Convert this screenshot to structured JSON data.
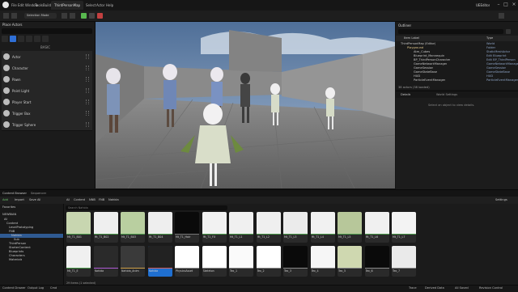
{
  "menubar": {
    "items": [
      "File",
      "Edit",
      "Window",
      "Tools",
      "Build",
      "Select",
      "Actor",
      "Help"
    ],
    "doc_tab": "ThirdPersonMap",
    "project": "UEEditor"
  },
  "toolbar": {
    "mode": "Selection Mode"
  },
  "place_actors": {
    "title": "Place Actors",
    "category": "BASIC",
    "items": [
      "Actor",
      "Character",
      "Pawn",
      "Point Light",
      "Player Start",
      "Trigger Box",
      "Trigger Sphere"
    ]
  },
  "outliner": {
    "title": "Outliner",
    "col_label": "Item Label",
    "col_type": "Type",
    "rows": [
      {
        "name": "ThirdPersonMap (Editor)",
        "type": "World"
      },
      {
        "name": "Playground",
        "type": "Folder"
      },
      {
        "name": "Atm_Cubes",
        "type": "StaticMeshActor"
      },
      {
        "name": "Blueprint_Mannequin",
        "type": "Edit Blueprint"
      },
      {
        "name": "BP_ThirdPersonCharacter",
        "type": "Edit BP_ThirdPerson"
      },
      {
        "name": "GameNetworkManager",
        "type": "GameNetworkManager"
      },
      {
        "name": "GameSession",
        "type": "GameSession"
      },
      {
        "name": "GameStateBase",
        "type": "GameStateBase"
      },
      {
        "name": "HUD",
        "type": "HUD"
      },
      {
        "name": "ParticleEventManager",
        "type": "ParticleEventManager"
      }
    ],
    "status": "38 actors (38 loaded)"
  },
  "details": {
    "tabs": [
      "Details",
      "World Settings"
    ],
    "message": "Select an object to view details."
  },
  "content_browser": {
    "tabs": [
      "Content Browser",
      "Sequencer"
    ],
    "add": "Add",
    "import": "Import",
    "save_all": "Save All",
    "breadcrumb": [
      "All",
      "Content",
      "NNB",
      "FNB",
      "Nahida"
    ],
    "settings": "Settings",
    "tree": [
      "Favorites",
      "NEWBIAN",
      "All",
      "Content",
      "LevelPrototyping",
      "FNB",
      "Nahida",
      "Sub",
      "ThirdPerson",
      "StarterContent",
      "Blueprints",
      "Characters",
      "Materials"
    ],
    "search_placeholder": "Search Nahida",
    "status": "29 items (1 selected)",
    "row1": [
      "Mt_T1_B01",
      "Mt_T1_B02",
      "Mt_T1_B03",
      "Mt_T1_B04",
      "Mt_T1_Hair",
      "Mt_T1_FX",
      "Mt_T1_L1",
      "Mt_T1_L2",
      "Mt_T1_L3",
      "Mt_T1_L4",
      "Mt_T1_L5",
      "Mt_T1_L6",
      "Mt_T1_L7"
    ],
    "row2": [
      "Mt_T1_E",
      "Nahida",
      "Nahida_Anim",
      "Nahida",
      "PhysicsAsset",
      "Skeleton",
      "Tex_1",
      "Tex_2",
      "Tex_3",
      "Tex_4",
      "Tex_5",
      "Tex_6",
      "Tex_7"
    ]
  },
  "status_bar": {
    "left": [
      "Content Drawer",
      "Output Log",
      "Cmd"
    ],
    "right": [
      "Trace",
      "Derived Data",
      "All Saved",
      "Revision Control"
    ]
  }
}
